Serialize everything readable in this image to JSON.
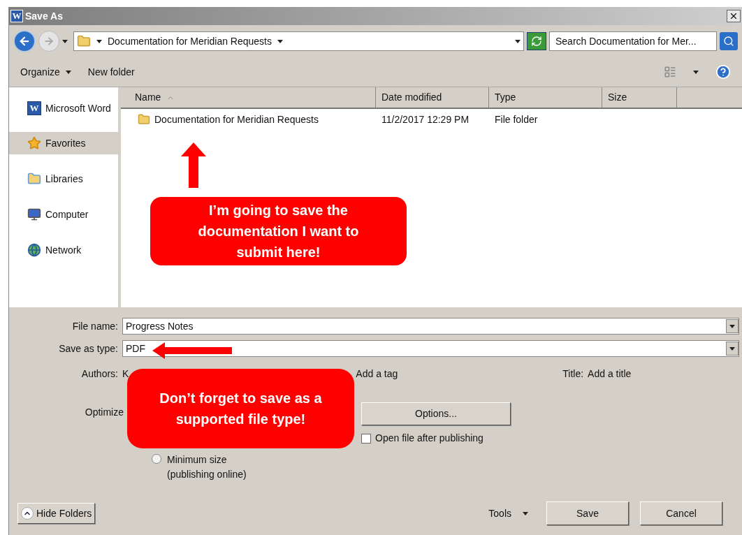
{
  "window": {
    "title": "Save As",
    "logo_text": "W"
  },
  "address": {
    "path": "Documentation for Meridian Requests",
    "search_placeholder": "Search Documentation for Mer..."
  },
  "toolbar": {
    "organize": "Organize",
    "new_folder": "New folder"
  },
  "sidebar": {
    "items": [
      {
        "label": "Microsoft Word",
        "logo_text": "W",
        "selected": false
      },
      {
        "label": "Favorites",
        "selected": true
      },
      {
        "label": "Libraries",
        "selected": false
      },
      {
        "label": "Computer",
        "selected": false
      },
      {
        "label": "Network",
        "selected": false
      }
    ]
  },
  "table": {
    "columns": [
      {
        "label": "Name",
        "sorted": true
      },
      {
        "label": "Date modified",
        "sorted": false
      },
      {
        "label": "Type",
        "sorted": false
      },
      {
        "label": "Size",
        "sorted": false
      }
    ],
    "rows": [
      {
        "name": "Documentation for Meridian Requests",
        "date_modified": "11/2/2017 12:29 PM",
        "type": "File folder"
      }
    ]
  },
  "form": {
    "file_name": {
      "label": "File name:",
      "value": "Progress Notes"
    },
    "save_as_type": {
      "label": "Save as type:",
      "value": "PDF"
    },
    "authors": {
      "label": "Authors:",
      "value": "K"
    },
    "tags": {
      "value": "Add a tag"
    },
    "title": {
      "label": "Title:",
      "value": "Add a title"
    },
    "optimize": {
      "label": "Optimize"
    },
    "minimum_size": {
      "label": "Minimum size",
      "sublabel": "(publishing online)",
      "selected": false
    },
    "options_button": "Options...",
    "open_after": {
      "label": "Open file after publishing",
      "checked": false
    }
  },
  "footer": {
    "hide_folders": "Hide Folders",
    "tools": "Tools",
    "save": "Save",
    "cancel": "Cancel"
  },
  "callouts": [
    {
      "text": "I’m going to save the documentation I want to submit here!"
    },
    {
      "text": "Don’t forget to save as a supported file type!"
    }
  ]
}
